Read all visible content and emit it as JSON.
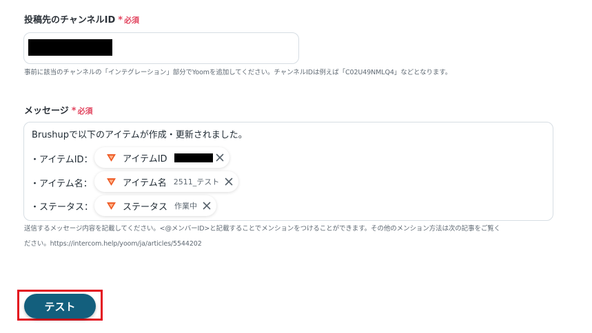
{
  "channel": {
    "label": "投稿先のチャンネルID",
    "required_mark": "*",
    "required_text": "必須",
    "hint": "事前に該当のチャンネルの「インテグレーション」部分でYoomを追加してください。チャンネルIDは例えば「C02U49NMLQ4」などとなります。"
  },
  "message": {
    "label": "メッセージ",
    "required_mark": "*",
    "required_text": "必須",
    "intro": "Brushupで以下のアイテムが作成・更新されました。",
    "rows": [
      {
        "prefix": "・アイテムID：",
        "tag_name": "アイテムID",
        "tag_value": ""
      },
      {
        "prefix": "・アイテム名：",
        "tag_name": "アイテム名",
        "tag_value": "2511_テスト"
      },
      {
        "prefix": "・ステータス：",
        "tag_name": "ステータス",
        "tag_value": "作業中"
      }
    ],
    "hint_line1": "送信するメッセージ内容を記載してください。<@メンバーID>と記載することでメンションをつけることができます。その他のメンション方法は次の記事をご覧く",
    "hint_line2": "ださい。https://intercom.help/yoom/ja/articles/5544202"
  },
  "actions": {
    "test_label": "テスト"
  },
  "icons": {
    "tag_icon": "brushup-logo-icon",
    "remove_icon": "close-icon"
  },
  "colors": {
    "required": "#e2455f",
    "primary_button": "#135f7d",
    "highlight_border": "#e3101e",
    "brushup_orange": "#ee5a24"
  }
}
